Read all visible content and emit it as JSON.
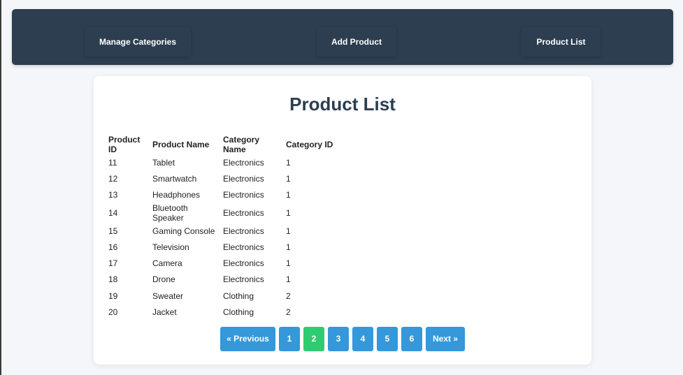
{
  "nav": {
    "items": [
      {
        "label": "Manage Categories"
      },
      {
        "label": "Add Product"
      },
      {
        "label": "Product List"
      }
    ]
  },
  "main": {
    "title": "Product List",
    "table": {
      "headers": [
        "Product ID",
        "Product Name",
        "Category Name",
        "Category ID"
      ],
      "rows": [
        [
          "11",
          "Tablet",
          "Electronics",
          "1"
        ],
        [
          "12",
          "Smartwatch",
          "Electronics",
          "1"
        ],
        [
          "13",
          "Headphones",
          "Electronics",
          "1"
        ],
        [
          "14",
          "Bluetooth Speaker",
          "Electronics",
          "1"
        ],
        [
          "15",
          "Gaming Console",
          "Electronics",
          "1"
        ],
        [
          "16",
          "Television",
          "Electronics",
          "1"
        ],
        [
          "17",
          "Camera",
          "Electronics",
          "1"
        ],
        [
          "18",
          "Drone",
          "Electronics",
          "1"
        ],
        [
          "19",
          "Sweater",
          "Clothing",
          "2"
        ],
        [
          "20",
          "Jacket",
          "Clothing",
          "2"
        ]
      ]
    },
    "pagination": {
      "prev_label": "« Previous",
      "next_label": "Next »",
      "pages": [
        "1",
        "2",
        "3",
        "4",
        "5",
        "6"
      ],
      "current": "2"
    }
  },
  "colors": {
    "navbar": "#2c3e50",
    "button": "#3498db",
    "active_page": "#2ecc71",
    "title": "#2c3e50"
  }
}
